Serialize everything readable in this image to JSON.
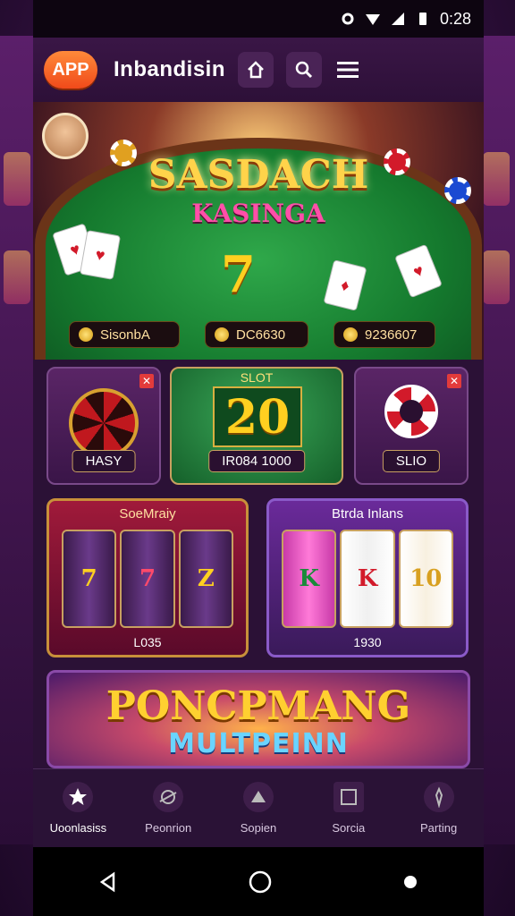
{
  "status_bar": {
    "time": "0:28"
  },
  "header": {
    "logo_text": "APP",
    "title": "Inbandisin"
  },
  "hero": {
    "title": "SASDACH",
    "subtitle": "KASINGA",
    "centerpiece": "7",
    "pills": [
      {
        "label": "SisonbA"
      },
      {
        "label": "DC6630"
      },
      {
        "label": "9236607"
      }
    ]
  },
  "tiles": [
    {
      "label": "HASY"
    },
    {
      "top_label": "SLOT",
      "number": "20",
      "label": "IR084 1000"
    },
    {
      "label": "SLIO"
    }
  ],
  "machines": [
    {
      "title": "SoeMraiy",
      "value": "L035",
      "symbols": [
        "7",
        "7",
        "Z"
      ]
    },
    {
      "title": "Btrda Inlans",
      "value": "1930",
      "symbols": [
        "K",
        "K",
        "10"
      ]
    }
  ],
  "banner": {
    "line1": "PONCPMANG",
    "line2": "MULTPEINN"
  },
  "nav": [
    {
      "label": "Uoonlasiss",
      "icon": "star-icon"
    },
    {
      "label": "Peonrion",
      "icon": "planet-icon"
    },
    {
      "label": "Sopien",
      "icon": "hat-icon"
    },
    {
      "label": "Sorcia",
      "icon": "frame-icon"
    },
    {
      "label": "Parting",
      "icon": "pen-icon"
    }
  ],
  "colors": {
    "accent": "#ff7a2a",
    "background": "#2b1136",
    "gold": "#ffd030",
    "pink": "#ff4fa8"
  }
}
